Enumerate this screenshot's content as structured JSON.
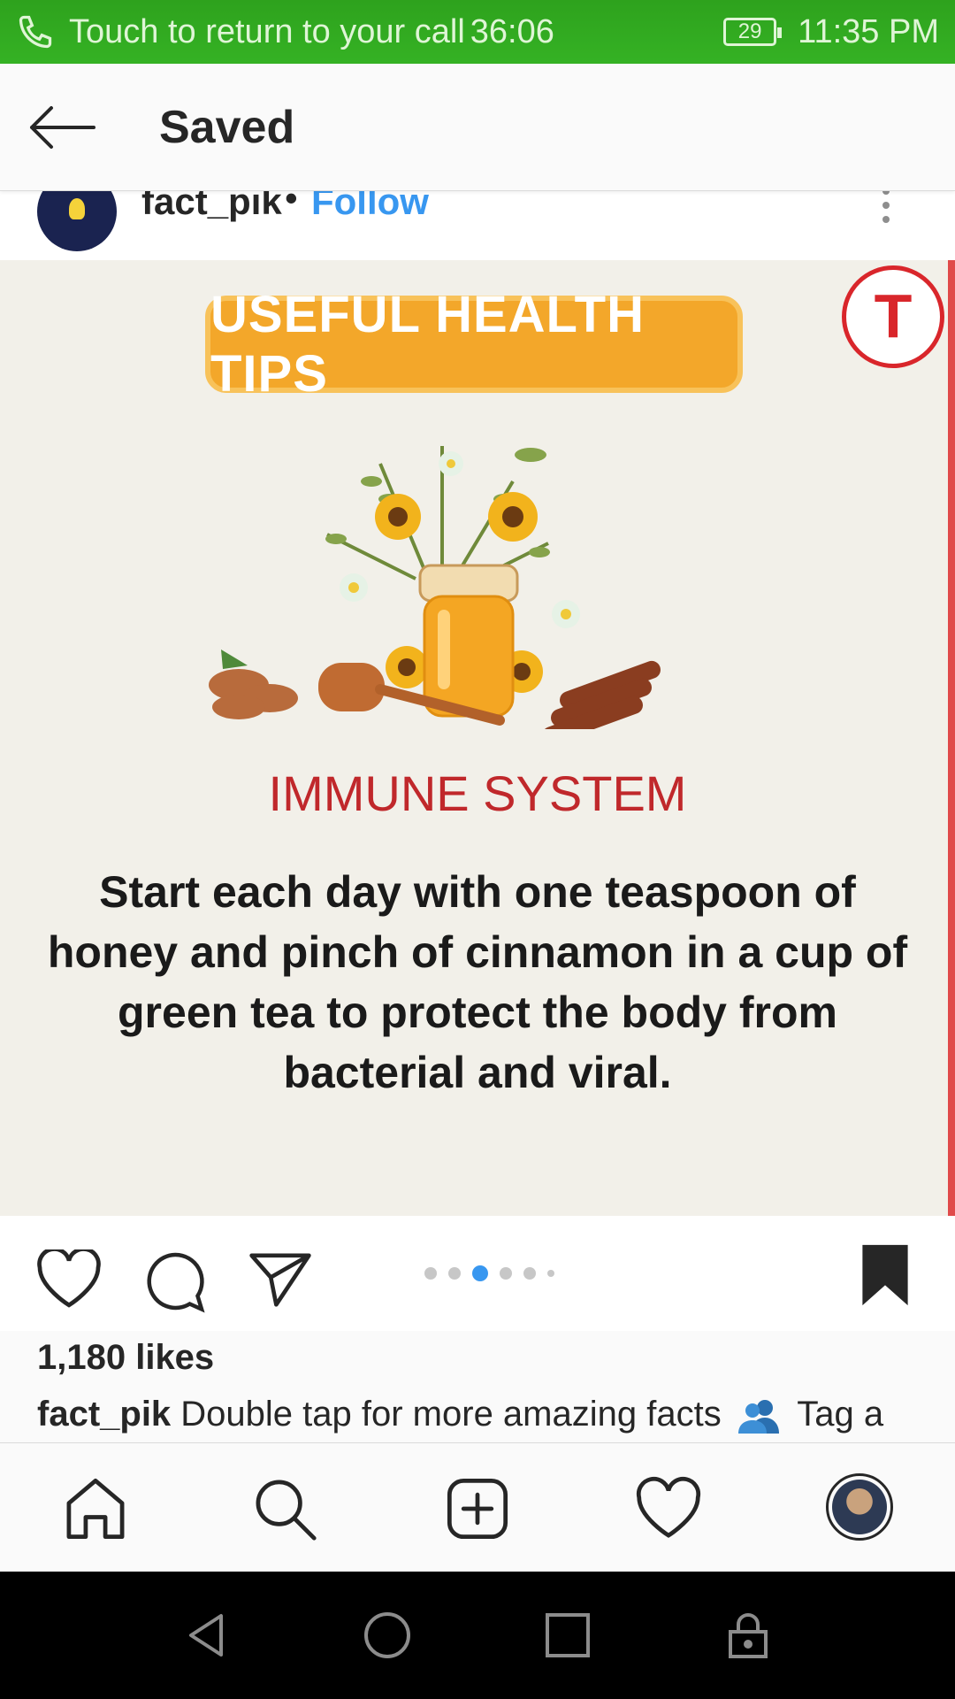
{
  "status_bar": {
    "call_text": "Touch to return to your call",
    "call_duration": "36:06",
    "battery": "29",
    "time": "11:35 PM"
  },
  "header": {
    "title": "Saved"
  },
  "post": {
    "username": "fact_pik",
    "separator": "•",
    "follow_label": "Follow",
    "image": {
      "banner": "USEFUL HEALTH TIPS",
      "logo_letter": "T",
      "heading": "IMMUNE SYSTEM",
      "body": "Start each day with one teaspoon of honey and pinch of cinnamon in a cup of green tea to protect the body from bacterial and viral."
    },
    "carousel": {
      "count": 6,
      "active_index": 2
    },
    "likes": "1,180 likes",
    "caption_user": "fact_pik",
    "caption_text": "Double tap for more amazing facts",
    "caption_tail": "Tag a"
  },
  "colors": {
    "status_green": "#2ea21d",
    "link_blue": "#3897f0",
    "heading_red": "#c0282b",
    "banner_orange": "#f3a72a"
  },
  "icons": {
    "actions": [
      "heart-icon",
      "comment-icon",
      "share-icon",
      "bookmark-icon"
    ],
    "nav": [
      "home-icon",
      "search-icon",
      "add-post-icon",
      "activity-heart-icon",
      "profile-avatar"
    ],
    "system": [
      "back-triangle-icon",
      "home-circle-icon",
      "recents-square-icon",
      "lock-icon"
    ]
  }
}
